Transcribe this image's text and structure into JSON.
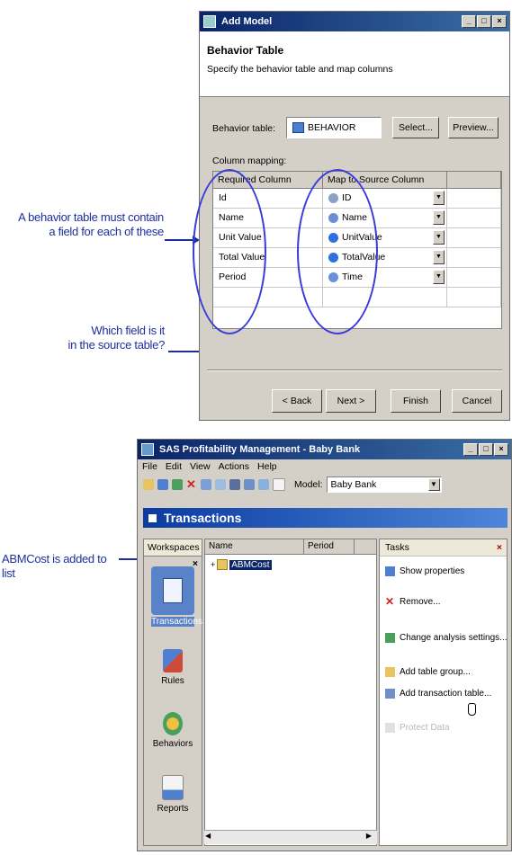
{
  "callouts": {
    "behavior_note_line1": "A behavior table must contain",
    "behavior_note_line2": "a field for each of these",
    "source_note_line1": "Which field is it",
    "source_note_line2": "in the source table?",
    "abm_note": "ABMCost is added to list"
  },
  "dialog": {
    "title": "Add Model",
    "heading": "Behavior Table",
    "subheading": "Specify the behavior table and map columns",
    "behavior_label": "Behavior table:",
    "behavior_value": "BEHAVIOR",
    "select_label": "Select...",
    "preview_label": "Preview...",
    "mapping_label": "Column mapping:",
    "col_required": "Required Column",
    "col_source": "Map to Source Column",
    "rows": [
      {
        "required": "Id",
        "source": "ID",
        "icon_color": "#8aa0c8"
      },
      {
        "required": "Name",
        "source": "Name",
        "icon_color": "#6a8fd8"
      },
      {
        "required": "Unit Value",
        "source": "UnitValue",
        "icon_color": "#2f6fe0"
      },
      {
        "required": "Total Value",
        "source": "TotalValue",
        "icon_color": "#2f6fe0"
      },
      {
        "required": "Period",
        "source": "Time",
        "icon_color": "#6a8fd8"
      }
    ],
    "buttons": {
      "back": "< Back",
      "next": "Next >",
      "finish": "Finish",
      "cancel": "Cancel"
    }
  },
  "app": {
    "title": "SAS Profitability Management - Baby Bank",
    "menu": [
      "File",
      "Edit",
      "View",
      "Actions",
      "Help"
    ],
    "model_label": "Model:",
    "model_value": "Baby Bank",
    "section_title": "Transactions",
    "workspaces_label": "Workspaces",
    "workspaces": [
      "Transactions",
      "Rules",
      "Behaviors",
      "Reports"
    ],
    "list_cols": [
      "Name",
      "Period"
    ],
    "list_item": "ABMCost",
    "tasks_label": "Tasks",
    "tasks": [
      "Show properties",
      "Remove...",
      "Change analysis settings...",
      "Add table group...",
      "Add transaction table...",
      "Protect Data"
    ]
  },
  "colors": {
    "callout": "#1d2f9e",
    "title_active": "#0a246a",
    "accent_band": "#0b3ba0"
  }
}
